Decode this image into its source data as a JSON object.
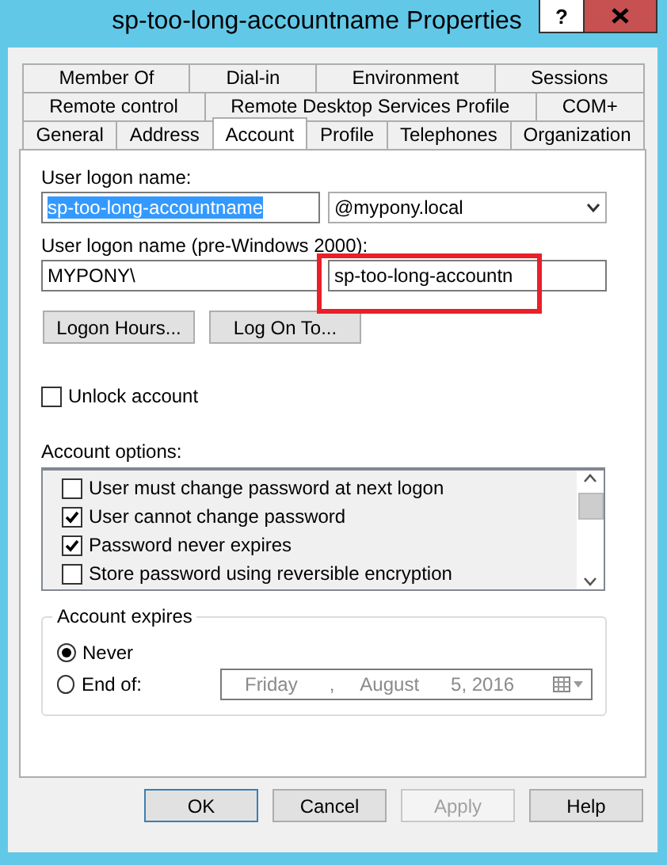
{
  "window": {
    "title": "sp-too-long-accountname Properties",
    "help_button": "?"
  },
  "tab_rows": [
    [
      {
        "label": "Member Of",
        "selected": false
      },
      {
        "label": "Dial-in",
        "selected": false
      },
      {
        "label": "Environment",
        "selected": false
      },
      {
        "label": "Sessions",
        "selected": false
      }
    ],
    [
      {
        "label": "Remote control",
        "selected": false
      },
      {
        "label": "Remote Desktop Services Profile",
        "selected": false
      },
      {
        "label": "COM+",
        "selected": false
      }
    ],
    [
      {
        "label": "General",
        "selected": false
      },
      {
        "label": "Address",
        "selected": false
      },
      {
        "label": "Account",
        "selected": true
      },
      {
        "label": "Profile",
        "selected": false
      },
      {
        "label": "Telephones",
        "selected": false
      },
      {
        "label": "Organization",
        "selected": false
      }
    ]
  ],
  "logon_name": {
    "label": "User logon name:",
    "value": "sp-too-long-accountname",
    "text_selected": true,
    "domain": "@mypony.local"
  },
  "pre_windows_2000": {
    "label": "User logon name (pre-Windows 2000):",
    "prefix": "MYPONY\\",
    "value": "sp-too-long-accountn",
    "highlighted": true
  },
  "logon_buttons": [
    "Logon Hours...",
    "Log On To..."
  ],
  "unlock_account": {
    "label": "Unlock account",
    "checked": false
  },
  "account_options": {
    "label": "Account options:",
    "items": [
      {
        "label": "User must change password at next logon",
        "checked": false
      },
      {
        "label": "User cannot change password",
        "checked": true
      },
      {
        "label": "Password never expires",
        "checked": true
      },
      {
        "label": "Store password using reversible encryption",
        "checked": false
      }
    ]
  },
  "account_expires": {
    "title": "Account expires",
    "options": [
      {
        "label": "Never",
        "selected": true
      },
      {
        "label": "End of:",
        "selected": false
      }
    ],
    "date": {
      "weekday": "Friday",
      "separator": ",",
      "month": "August",
      "day_year": "5, 2016",
      "disabled": true
    }
  },
  "buttons": [
    {
      "label": "OK",
      "default": true,
      "disabled": false
    },
    {
      "label": "Cancel",
      "default": false,
      "disabled": false
    },
    {
      "label": "Apply",
      "default": false,
      "disabled": true
    },
    {
      "label": "Help",
      "default": false,
      "disabled": false
    }
  ]
}
